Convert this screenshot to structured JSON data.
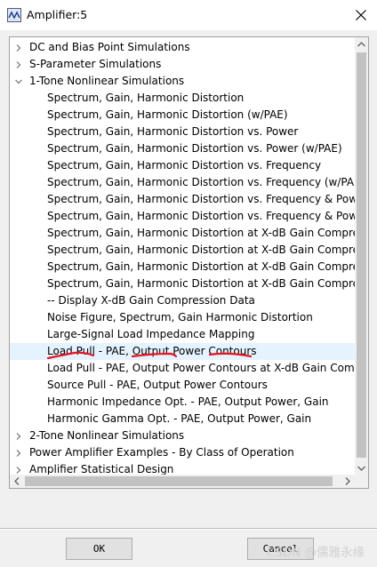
{
  "window": {
    "title": "Amplifier:5"
  },
  "tree": {
    "items": [
      {
        "label": "DC and Bias Point Simulations",
        "level": 0,
        "state": "collapsed"
      },
      {
        "label": "S-Parameter Simulations",
        "level": 0,
        "state": "collapsed"
      },
      {
        "label": "1-Tone Nonlinear Simulations",
        "level": 0,
        "state": "expanded"
      },
      {
        "label": "Spectrum, Gain, Harmonic Distortion",
        "level": 1
      },
      {
        "label": "Spectrum, Gain, Harmonic Distortion (w/PAE)",
        "level": 1
      },
      {
        "label": "Spectrum, Gain, Harmonic Distortion vs. Power",
        "level": 1
      },
      {
        "label": "Spectrum, Gain, Harmonic Distortion vs. Power (w/PAE)",
        "level": 1
      },
      {
        "label": "Spectrum, Gain, Harmonic Distortion vs. Frequency",
        "level": 1
      },
      {
        "label": "Spectrum, Gain, Harmonic Distortion vs. Frequency (w/PAE)",
        "level": 1
      },
      {
        "label": "Spectrum, Gain, Harmonic Distortion vs. Frequency & Power",
        "level": 1
      },
      {
        "label": "Spectrum, Gain, Harmonic Distortion vs. Frequency & Power",
        "level": 1
      },
      {
        "label": "Spectrum, Gain, Harmonic Distortion at X-dB Gain Compression",
        "level": 1
      },
      {
        "label": "Spectrum, Gain, Harmonic Distortion at X-dB Gain Compression",
        "level": 1
      },
      {
        "label": "Spectrum, Gain, Harmonic Distortion at X-dB Gain Compression",
        "level": 1
      },
      {
        "label": "Spectrum, Gain, Harmonic Distortion at X-dB Gain Compression",
        "level": 1
      },
      {
        "label": "-- Display X-dB Gain Compression Data",
        "level": 1
      },
      {
        "label": "Noise Figure, Spectrum, Gain Harmonic Distortion",
        "level": 1
      },
      {
        "label": "Large-Signal Load Impedance Mapping",
        "level": 1
      },
      {
        "label": "Load Pull - PAE, Output Power Contours",
        "level": 1,
        "selected": true
      },
      {
        "label": "Load Pull - PAE, Output Power Contours at X-dB Gain Compression",
        "level": 1
      },
      {
        "label": "Source Pull - PAE, Output Power Contours",
        "level": 1
      },
      {
        "label": "Harmonic Impedance Opt. - PAE, Output Power, Gain",
        "level": 1
      },
      {
        "label": "Harmonic Gamma Opt. - PAE, Output Power, Gain",
        "level": 1
      },
      {
        "label": "2-Tone Nonlinear Simulations",
        "level": 0,
        "state": "collapsed"
      },
      {
        "label": "Power Amplifier Examples - By Class of Operation",
        "level": 0,
        "state": "collapsed"
      },
      {
        "label": "Amplifier Statistical Design",
        "level": 0,
        "state": "collapsed"
      }
    ]
  },
  "buttons": {
    "ok": "OK",
    "cancel": "Cancel"
  },
  "watermark": "CSDN @儒雅永缘",
  "colors": {
    "selection": "#e5f3ff",
    "annotation": "#e8141e"
  },
  "icons": {
    "close": "close-icon",
    "app": "amplifier-app-icon"
  }
}
